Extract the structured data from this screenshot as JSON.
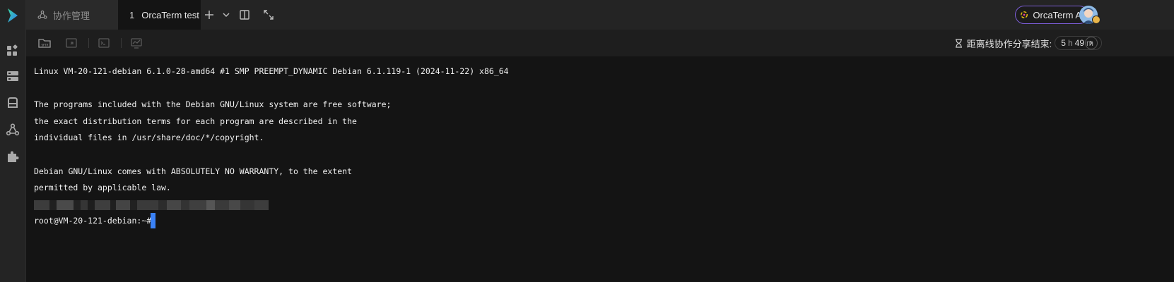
{
  "tabs": [
    {
      "label": "协作管理",
      "icon": "collaboration-icon"
    },
    {
      "number": "1",
      "label": "OrcaTerm test"
    }
  ],
  "tab_actions": {
    "add_icon": "plus-icon",
    "dropdown_icon": "chevron-down-icon",
    "split_icon": "split-view-icon",
    "fullscreen_icon": "expand-icon"
  },
  "header": {
    "ai_button_label": "OrcaTerm AI"
  },
  "toolbar": {
    "sftp_label": "SFTP",
    "timer_label": "距离线协作分享结束:",
    "timer_hours": "5",
    "timer_hours_unit": "h",
    "timer_minutes": "49",
    "timer_minutes_unit": "m"
  },
  "terminal": {
    "lines": [
      "Linux VM-20-121-debian 6.1.0-28-amd64 #1 SMP PREEMPT_DYNAMIC Debian 6.1.119-1 (2024-11-22) x86_64",
      "The programs included with the Debian GNU/Linux system are free software;",
      "the exact distribution terms for each program are described in the",
      "individual files in /usr/share/doc/*/copyright.",
      "Debian GNU/Linux comes with ABSOLUTELY NO WARRANTY, to the extent",
      "permitted by applicable law.",
      "root@VM-20-121-debian:~# "
    ]
  },
  "colors": {
    "accent_blue": "#3a82f7",
    "ai_border": "#7b5cd6",
    "terminal_bg": "#141414",
    "chrome_bg": "#242424"
  }
}
